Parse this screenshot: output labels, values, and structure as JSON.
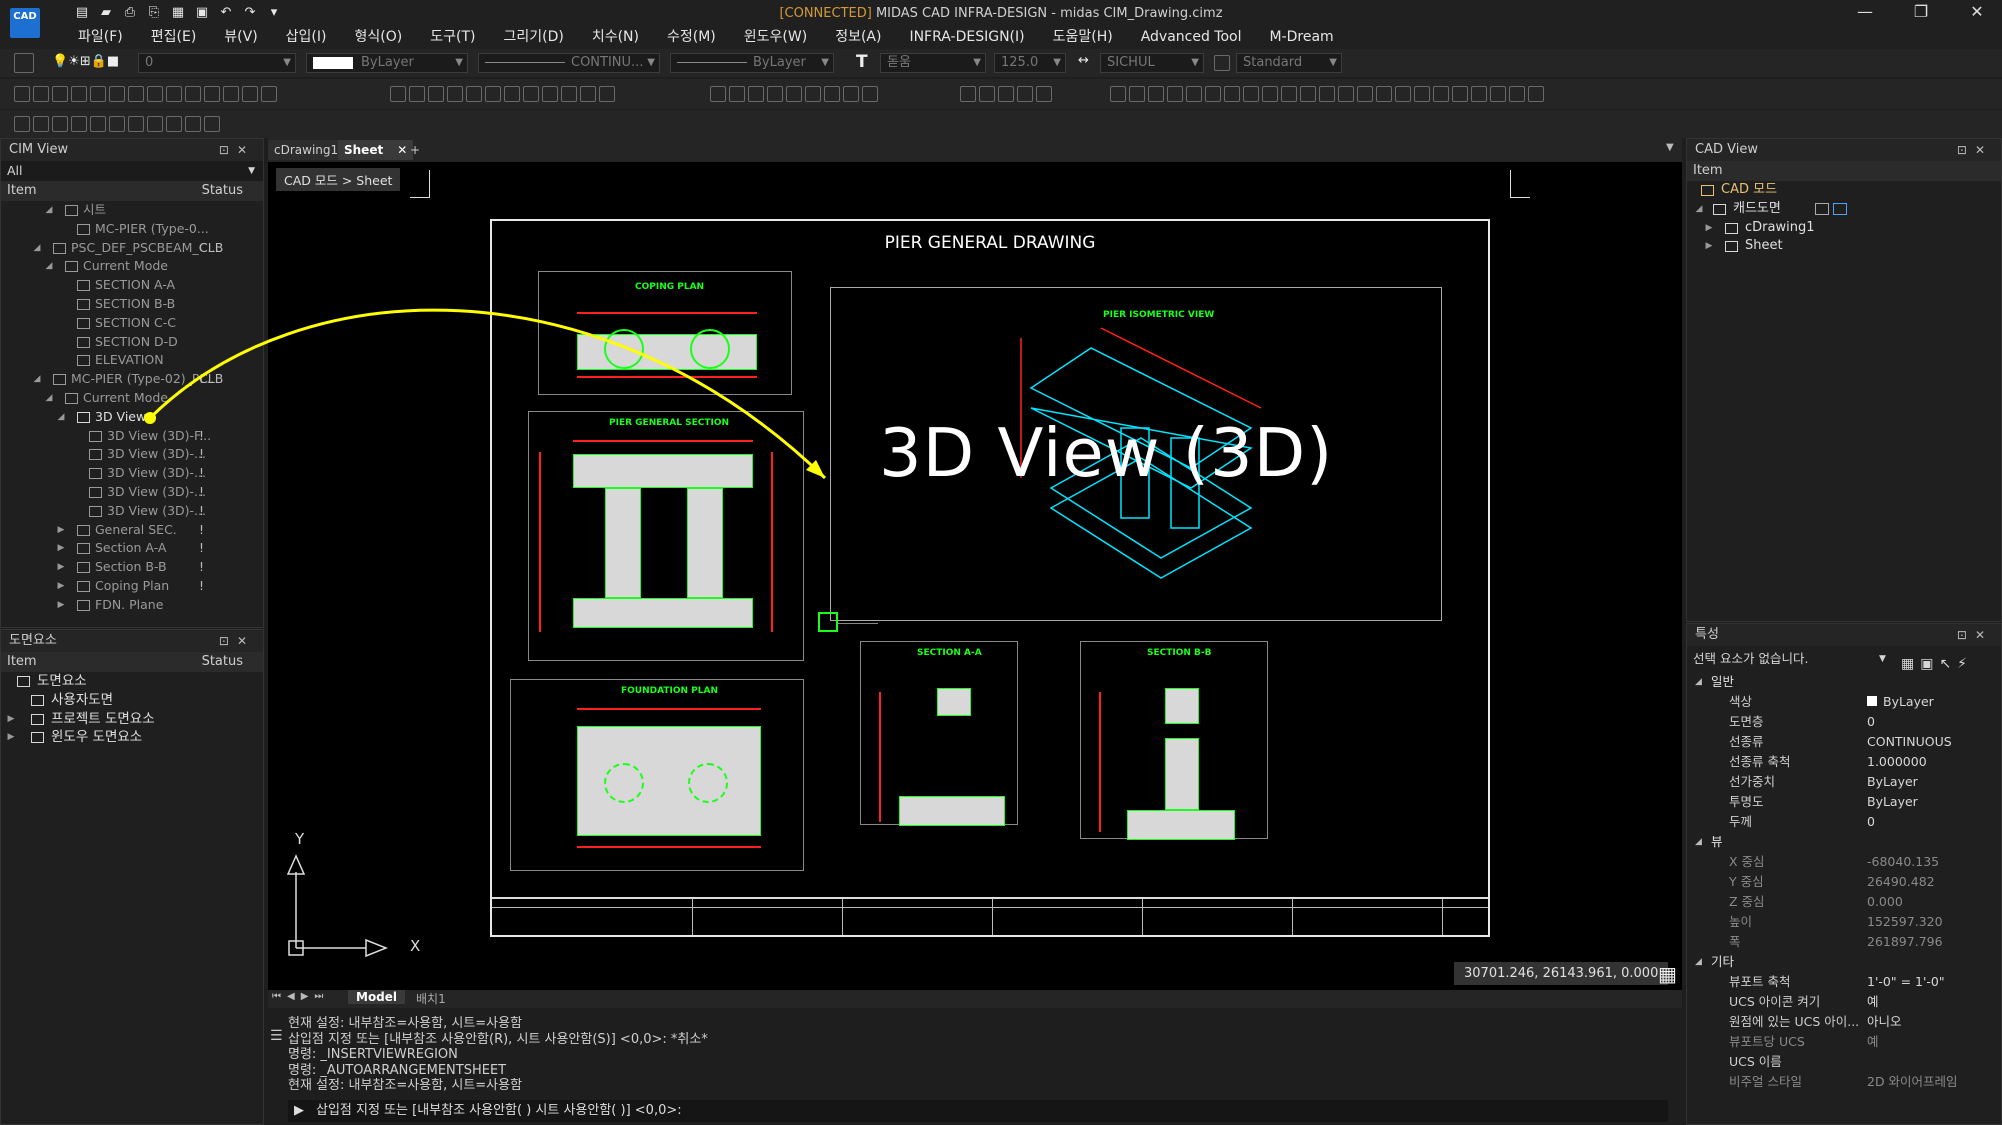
{
  "app": {
    "logo_text": "CAD",
    "connection": "[CONNECTED]",
    "title_rest": " MIDAS CAD INFRA-DESIGN - midas CIM_Drawing.cimz",
    "window_controls": [
      "—",
      "❐",
      "✕"
    ]
  },
  "menu": [
    "파일(F)",
    "편집(E)",
    "뷰(V)",
    "삽입(I)",
    "형식(O)",
    "도구(T)",
    "그리기(D)",
    "치수(N)",
    "수정(M)",
    "윈도우(W)",
    "정보(A)",
    "INFRA-DESIGN(I)",
    "도움말(H)",
    "Advanced Tool",
    "M-Dream"
  ],
  "toolbar": {
    "layer": "0",
    "color": "ByLayer",
    "linetype": "CONTINU...",
    "lineweight": "ByLayer",
    "textstyle": "돋움",
    "textheight": "125.0",
    "dimstyle": "SICHUL",
    "tablestyle": "Standard"
  },
  "cim_view": {
    "title": "CIM View",
    "filter": "All",
    "col_item": "Item",
    "col_status": "Status",
    "rows": [
      {
        "label": "시트",
        "status": ""
      },
      {
        "label": "MC-PIER (Type-0...",
        "status": ""
      },
      {
        "label": "PSC_DEF_PSCBEAM_C...",
        "status": "CLB"
      },
      {
        "label": "Current Mode",
        "status": ""
      },
      {
        "label": "SECTION A-A",
        "status": ""
      },
      {
        "label": "SECTION B-B",
        "status": ""
      },
      {
        "label": "SECTION C-C",
        "status": ""
      },
      {
        "label": "SECTION D-D",
        "status": ""
      },
      {
        "label": "ELEVATION",
        "status": ""
      },
      {
        "label": "MC-PIER (Type-02)_PL...",
        "status": "CLB"
      },
      {
        "label": "Current Mode",
        "status": ""
      },
      {
        "label": "3D View",
        "status": ""
      },
      {
        "label": "3D View (3D)-F...",
        "status": "!"
      },
      {
        "label": "3D View (3D)-...",
        "status": "!"
      },
      {
        "label": "3D View (3D)-...",
        "status": "!"
      },
      {
        "label": "3D View (3D)-...",
        "status": "!"
      },
      {
        "label": "3D View (3D)-...",
        "status": "!"
      },
      {
        "label": "General SEC.",
        "status": "!"
      },
      {
        "label": "Section A-A",
        "status": "!"
      },
      {
        "label": "Section B-B",
        "status": "!"
      },
      {
        "label": "Coping Plan",
        "status": "!"
      },
      {
        "label": "FDN. Plane",
        "status": ""
      }
    ]
  },
  "drawing_elements": {
    "title": "도면요소",
    "col_item": "Item",
    "col_status": "Status",
    "rows": [
      {
        "label": "도면요소"
      },
      {
        "label": "사용자도면"
      },
      {
        "label": "프로젝트 도면요소"
      },
      {
        "label": "윈도우 도면요소"
      }
    ]
  },
  "tabs": {
    "first": "cDrawing1",
    "active": "Sheet",
    "add": "+"
  },
  "breadcrumb": "CAD 모드 > Sheet",
  "drawing": {
    "title": "PIER GENERAL DRAWING",
    "view_label": "3D View (3D)",
    "coping_plan": "COPING PLAN",
    "general_section": "PIER GENERAL SECTION",
    "isometric": "PIER ISOMETRIC VIEW",
    "foundation_plan": "FOUNDATION PLAN",
    "section_a": "SECTION A-A",
    "section_b": "SECTION B-B",
    "ucs_y": "Y",
    "ucs_x": "X"
  },
  "coords": "30701.246, 26143.961, 0.000",
  "layout_tabs": {
    "model": "Model",
    "layout": "배치1"
  },
  "command": {
    "lines": [
      "현재 설정: 내부참조=사용함, 시트=사용함",
      "삽입점 지정 또는 [내부참조 사용안함(R), 시트 사용안함(S)] <0,0>: *취소*",
      "명령: _INSERTVIEWREGION",
      "명령: _AUTOARRANGEMENTSHEET",
      "현재 설정: 내부참조=사용함, 시트=사용함"
    ],
    "prompt": "삽입점 지정 또는 [내부참조 사용안함( ) 시트 사용안함( )] <0,0>:"
  },
  "cad_view": {
    "title": "CAD View",
    "col_item": "Item",
    "rows": [
      {
        "label": "CAD 모드"
      },
      {
        "label": "캐드도면"
      },
      {
        "label": "cDrawing1"
      },
      {
        "label": "Sheet"
      }
    ]
  },
  "properties": {
    "title": "특성",
    "selection": "선택 요소가 없습니다.",
    "rows": [
      {
        "type": "sec",
        "k": "일반",
        "v": ""
      },
      {
        "k": "색상",
        "v": "ByLayer"
      },
      {
        "k": "도면층",
        "v": "0"
      },
      {
        "k": "선종류",
        "v": "CONTINUOUS"
      },
      {
        "k": "선종류 축척",
        "v": "1.000000"
      },
      {
        "k": "선가중치",
        "v": "ByLayer"
      },
      {
        "k": "투명도",
        "v": "ByLayer"
      },
      {
        "k": "두께",
        "v": "0"
      },
      {
        "type": "sec",
        "k": "뷰",
        "v": ""
      },
      {
        "type": "dim",
        "k": "X 중심",
        "v": "-68040.135"
      },
      {
        "type": "dim",
        "k": "Y 중심",
        "v": "26490.482"
      },
      {
        "type": "dim",
        "k": "Z 중심",
        "v": "0.000"
      },
      {
        "type": "dim",
        "k": "높이",
        "v": "152597.320"
      },
      {
        "type": "dim",
        "k": "폭",
        "v": "261897.796"
      },
      {
        "type": "sec",
        "k": "기타",
        "v": ""
      },
      {
        "k": "뷰포트 축척",
        "v": "1'-0\" = 1'-0\""
      },
      {
        "k": "UCS 아이콘 켜기",
        "v": "예"
      },
      {
        "k": "원점에 있는 UCS 아이...",
        "v": "아니오"
      },
      {
        "type": "dim",
        "k": "뷰포트당 UCS",
        "v": "예"
      },
      {
        "k": "UCS 이름",
        "v": ""
      },
      {
        "type": "dim",
        "k": "비주얼 스타일",
        "v": "2D 와이어프레임"
      }
    ]
  },
  "colors": {
    "accent": "#ffff00",
    "drawing_green": "#19ff19",
    "cyan": "#00e5ff",
    "red": "#ff2020"
  }
}
